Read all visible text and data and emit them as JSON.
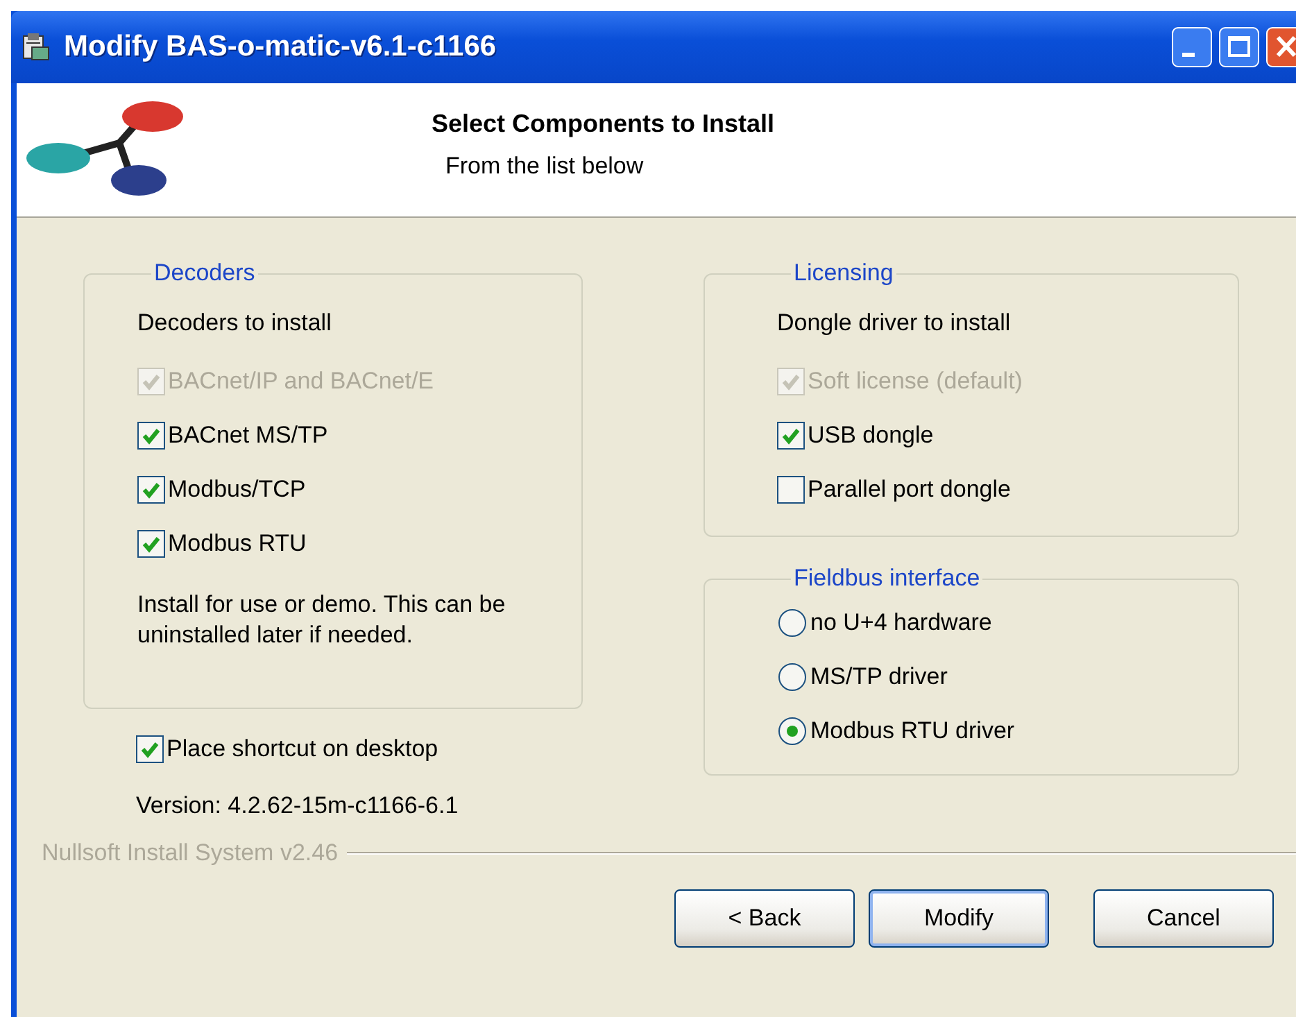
{
  "window": {
    "title": "Modify BAS-o-matic-v6.1-c1166"
  },
  "header": {
    "title": "Select Components to Install",
    "subtitle": "From the list below"
  },
  "decoders": {
    "title": "Decoders",
    "label": "Decoders to install",
    "options": [
      {
        "label": "BACnet/IP and BACnet/E",
        "checked": true,
        "disabled": true
      },
      {
        "label": "BACnet MS/TP",
        "checked": true,
        "disabled": false
      },
      {
        "label": "Modbus/TCP",
        "checked": true,
        "disabled": false
      },
      {
        "label": "Modbus RTU",
        "checked": true,
        "disabled": false
      }
    ],
    "note": "Install for use or demo. This can be uninstalled later if needed."
  },
  "shortcut": {
    "label": "Place shortcut on desktop",
    "checked": true
  },
  "version": "Version: 4.2.62-15m-c1166-6.1",
  "licensing": {
    "title": "Licensing",
    "label": "Dongle driver to install",
    "options": [
      {
        "label": "Soft license (default)",
        "checked": true,
        "disabled": true
      },
      {
        "label": "USB dongle",
        "checked": true,
        "disabled": false
      },
      {
        "label": "Parallel port dongle",
        "checked": false,
        "disabled": false
      }
    ]
  },
  "fieldbus": {
    "title": "Fieldbus interface",
    "options": [
      {
        "label": "no U+4 hardware",
        "selected": false
      },
      {
        "label": "MS/TP driver",
        "selected": false
      },
      {
        "label": "Modbus RTU driver",
        "selected": true
      }
    ]
  },
  "branding": "Nullsoft Install System v2.46",
  "buttons": [
    {
      "label": "< Back",
      "default": false
    },
    {
      "label": "Modify",
      "default": true
    },
    {
      "label": "Cancel",
      "default": false
    }
  ]
}
